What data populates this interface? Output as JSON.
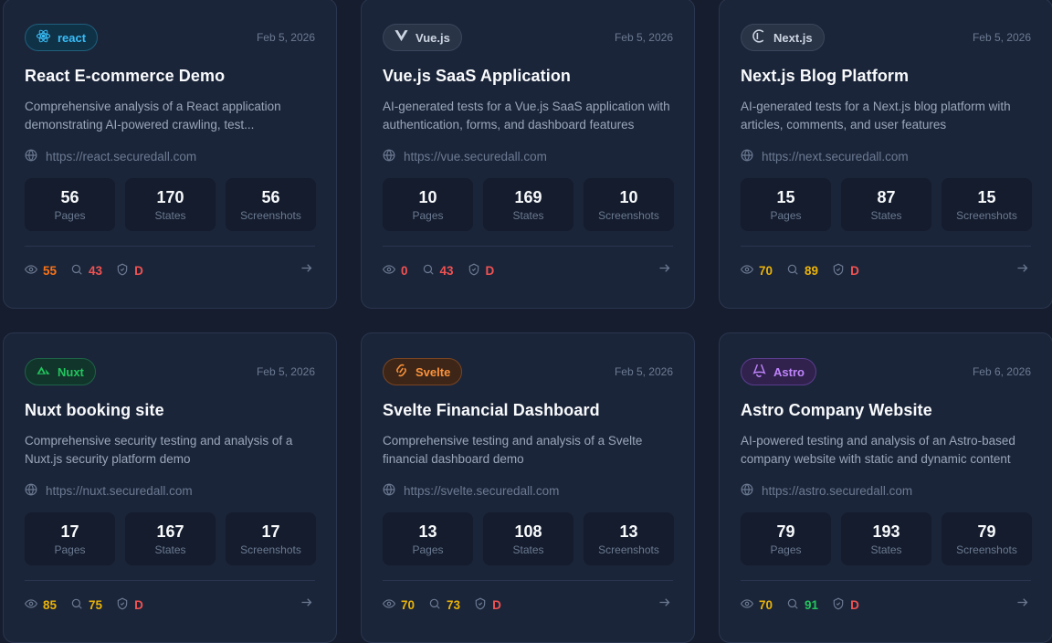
{
  "labels": {
    "pages": "Pages",
    "states": "States",
    "screenshots": "Screenshots"
  },
  "colors": {
    "orange": "#f97316",
    "red": "#f05252",
    "yellow": "#eab308",
    "green": "#22c55e",
    "react": "#38bdf8",
    "vue": "#cbd5e1",
    "next": "#cbd5e1",
    "nuxt": "#22c55e",
    "svelte": "#fb923c",
    "astro": "#c084fc"
  },
  "cards": [
    {
      "badge": "react",
      "badge_icon": "react-icon",
      "date": "Feb 5, 2026",
      "title": "React E-commerce Demo",
      "description": "Comprehensive analysis of a React application demonstrating AI-powered crawling, test...",
      "url": "https://react.securedall.com",
      "pages": "56",
      "states": "170",
      "screenshots": "56",
      "views": "55",
      "searches": "43",
      "grade": "D",
      "views_color": "orange",
      "searches_color": "red"
    },
    {
      "badge": "Vue.js",
      "badge_icon": "vue-icon",
      "date": "Feb 5, 2026",
      "title": "Vue.js SaaS Application",
      "description": "AI-generated tests for a Vue.js SaaS application with authentication, forms, and dashboard features",
      "url": "https://vue.securedall.com",
      "pages": "10",
      "states": "169",
      "screenshots": "10",
      "views": "0",
      "searches": "43",
      "grade": "D",
      "views_color": "red",
      "searches_color": "red"
    },
    {
      "badge": "Next.js",
      "badge_icon": "next-icon",
      "date": "Feb 5, 2026",
      "title": "Next.js Blog Platform",
      "description": "AI-generated tests for a Next.js blog platform with articles, comments, and user features",
      "url": "https://next.securedall.com",
      "pages": "15",
      "states": "87",
      "screenshots": "15",
      "views": "70",
      "searches": "89",
      "grade": "D",
      "views_color": "yellow",
      "searches_color": "yellow"
    },
    {
      "badge": "Nuxt",
      "badge_icon": "nuxt-icon",
      "date": "Feb 5, 2026",
      "title": "Nuxt booking site",
      "description": "Comprehensive security testing and analysis of a Nuxt.js security platform demo",
      "url": "https://nuxt.securedall.com",
      "pages": "17",
      "states": "167",
      "screenshots": "17",
      "views": "85",
      "searches": "75",
      "grade": "D",
      "views_color": "yellow",
      "searches_color": "yellow"
    },
    {
      "badge": "Svelte",
      "badge_icon": "svelte-icon",
      "date": "Feb 5, 2026",
      "title": "Svelte Financial Dashboard",
      "description": "Comprehensive testing and analysis of a Svelte financial dashboard demo",
      "url": "https://svelte.securedall.com",
      "pages": "13",
      "states": "108",
      "screenshots": "13",
      "views": "70",
      "searches": "73",
      "grade": "D",
      "views_color": "yellow",
      "searches_color": "yellow"
    },
    {
      "badge": "Astro",
      "badge_icon": "astro-icon",
      "date": "Feb 6, 2026",
      "title": "Astro Company Website",
      "description": "AI-powered testing and analysis of an Astro-based company website with static and dynamic content",
      "url": "https://astro.securedall.com",
      "pages": "79",
      "states": "193",
      "screenshots": "79",
      "views": "70",
      "searches": "91",
      "grade": "D",
      "views_color": "yellow",
      "searches_color": "green"
    }
  ]
}
